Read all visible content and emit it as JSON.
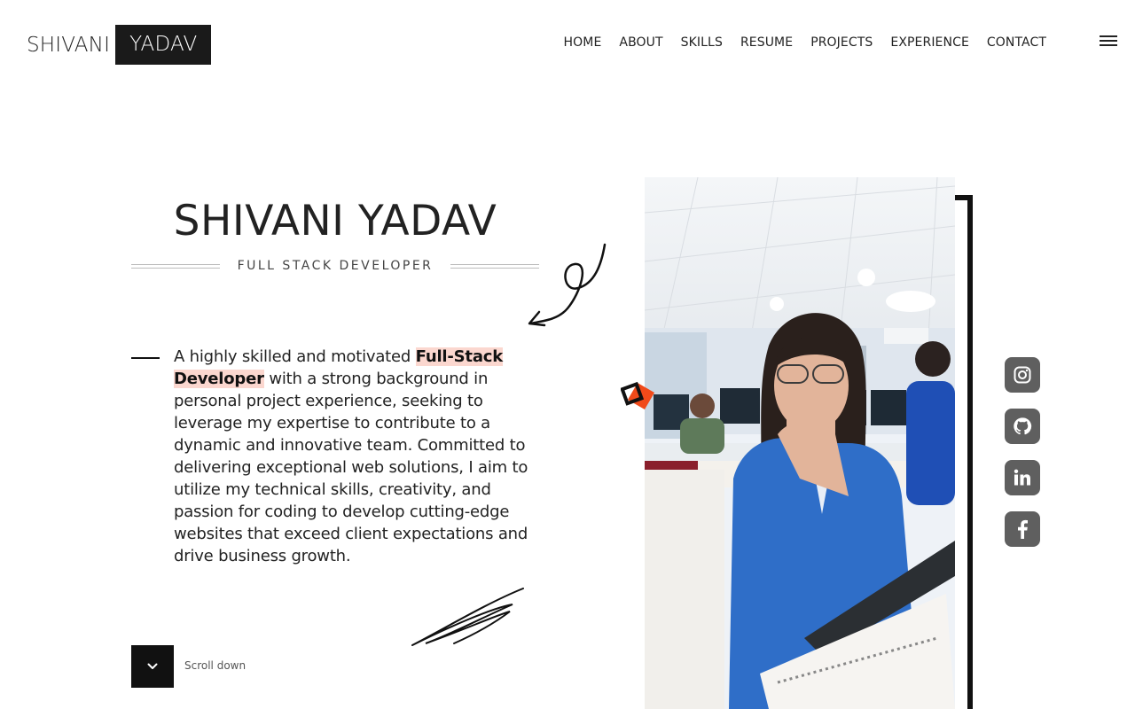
{
  "header": {
    "logo_first": "SHIVANI",
    "logo_last": "YADAV",
    "nav": [
      "HOME",
      "ABOUT",
      "SKILLS",
      "RESUME",
      "PROJECTS",
      "EXPERIENCE",
      "CONTACT"
    ]
  },
  "hero": {
    "title": "SHIVANI YADAV",
    "subtitle": "FULL STACK DEVELOPER",
    "intro_before": "A highly skilled and motivated ",
    "intro_highlight": "Full-Stack Developer",
    "intro_after": " with a strong background in personal project experience, seeking to leverage my expertise to contribute to a dynamic and innovative team. Committed to delivering exceptional web solutions, I aim to utilize my technical skills, creativity, and passion for coding to develop cutting-edge websites that exceed client expectations and drive business growth.",
    "scroll_label": "Scroll down"
  },
  "social": [
    "instagram-icon",
    "github-icon",
    "linkedin-icon",
    "facebook-icon"
  ],
  "colors": {
    "accent_highlight": "#fbd7cf",
    "dark": "#111111",
    "social_bg": "#5f5f5f",
    "deco_orange": "#f04a1a"
  }
}
